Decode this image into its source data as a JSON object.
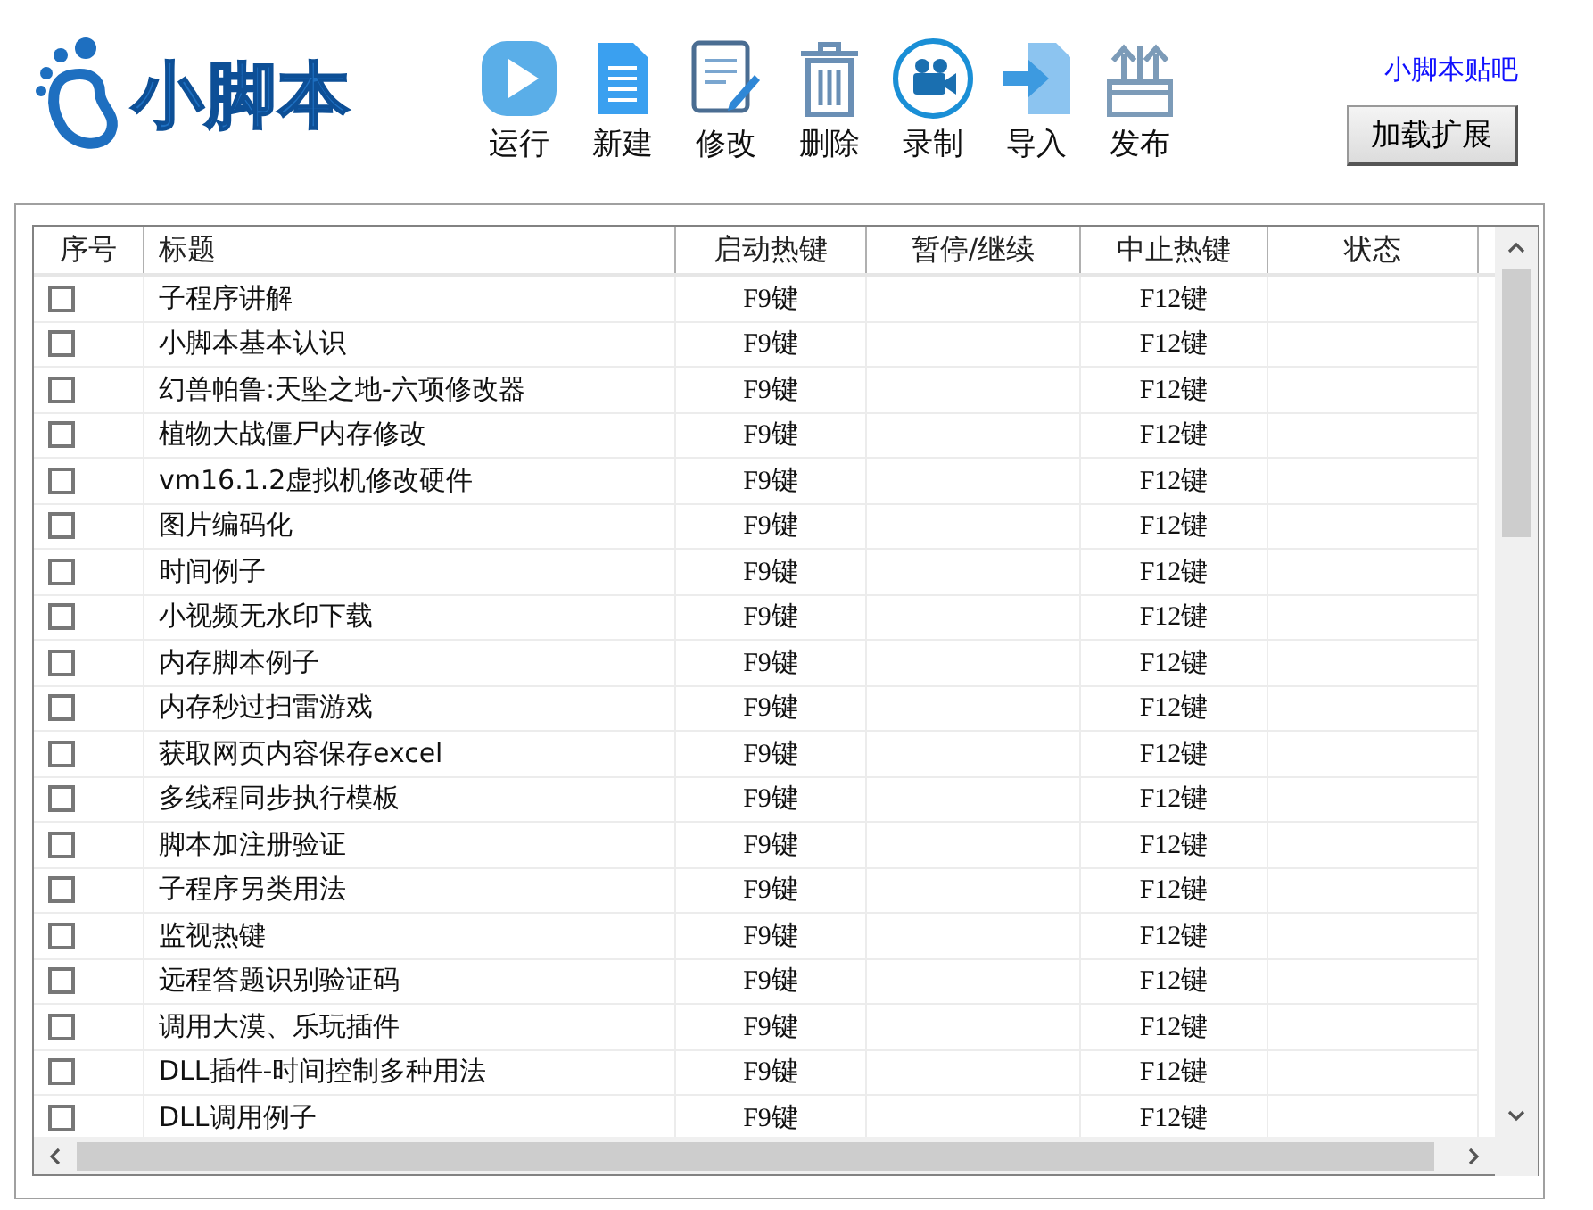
{
  "app": {
    "logo_text": "小脚本"
  },
  "toolbar": [
    {
      "kind": "run",
      "label": "运行"
    },
    {
      "kind": "new",
      "label": "新建"
    },
    {
      "kind": "edit",
      "label": "修改"
    },
    {
      "kind": "delete",
      "label": "删除"
    },
    {
      "kind": "record",
      "label": "录制"
    },
    {
      "kind": "import",
      "label": "导入"
    },
    {
      "kind": "publish",
      "label": "发布"
    }
  ],
  "forum_link": "小脚本贴吧",
  "extension_button": "加载扩展",
  "table": {
    "columns": [
      "序号",
      "标题",
      "启动热键",
      "暂停/继续",
      "中止热键",
      "状态"
    ],
    "rows": [
      {
        "checked": false,
        "title": "子程序讲解",
        "start_hotkey": "F9键",
        "stop_hotkey": "F12键"
      },
      {
        "checked": false,
        "title": "小脚本基本认识",
        "start_hotkey": "F9键",
        "stop_hotkey": "F12键"
      },
      {
        "checked": false,
        "title": "幻兽帕鲁:天坠之地-六项修改器",
        "start_hotkey": "F9键",
        "stop_hotkey": "F12键"
      },
      {
        "checked": false,
        "title": "植物大战僵尸内存修改",
        "start_hotkey": "F9键",
        "stop_hotkey": "F12键"
      },
      {
        "checked": false,
        "title": "vm16.1.2虚拟机修改硬件",
        "start_hotkey": "F9键",
        "stop_hotkey": "F12键"
      },
      {
        "checked": false,
        "title": "图片编码化",
        "start_hotkey": "F9键",
        "stop_hotkey": "F12键"
      },
      {
        "checked": false,
        "title": "时间例子",
        "start_hotkey": "F9键",
        "stop_hotkey": "F12键"
      },
      {
        "checked": false,
        "title": "小视频无水印下载",
        "start_hotkey": "F9键",
        "stop_hotkey": "F12键"
      },
      {
        "checked": false,
        "title": "内存脚本例子",
        "start_hotkey": "F9键",
        "stop_hotkey": "F12键"
      },
      {
        "checked": false,
        "title": "内存秒过扫雷游戏",
        "start_hotkey": "F9键",
        "stop_hotkey": "F12键"
      },
      {
        "checked": false,
        "title": "获取网页内容保存excel",
        "start_hotkey": "F9键",
        "stop_hotkey": "F12键"
      },
      {
        "checked": false,
        "title": "多线程同步执行模板",
        "start_hotkey": "F9键",
        "stop_hotkey": "F12键"
      },
      {
        "checked": false,
        "title": "脚本加注册验证",
        "start_hotkey": "F9键",
        "stop_hotkey": "F12键"
      },
      {
        "checked": false,
        "title": "子程序另类用法",
        "start_hotkey": "F9键",
        "stop_hotkey": "F12键"
      },
      {
        "checked": false,
        "title": "监视热键",
        "start_hotkey": "F9键",
        "stop_hotkey": "F12键"
      },
      {
        "checked": false,
        "title": "远程答题识别验证码",
        "start_hotkey": "F9键",
        "stop_hotkey": "F12键"
      },
      {
        "checked": false,
        "title": "调用大漠、乐玩插件",
        "start_hotkey": "F9键",
        "stop_hotkey": "F12键"
      },
      {
        "checked": false,
        "title": "DLL插件-时间控制多种用法",
        "start_hotkey": "F9键",
        "stop_hotkey": "F12键"
      },
      {
        "checked": false,
        "title": "DLL调用例子",
        "start_hotkey": "F9键",
        "stop_hotkey": "F12键"
      }
    ]
  }
}
